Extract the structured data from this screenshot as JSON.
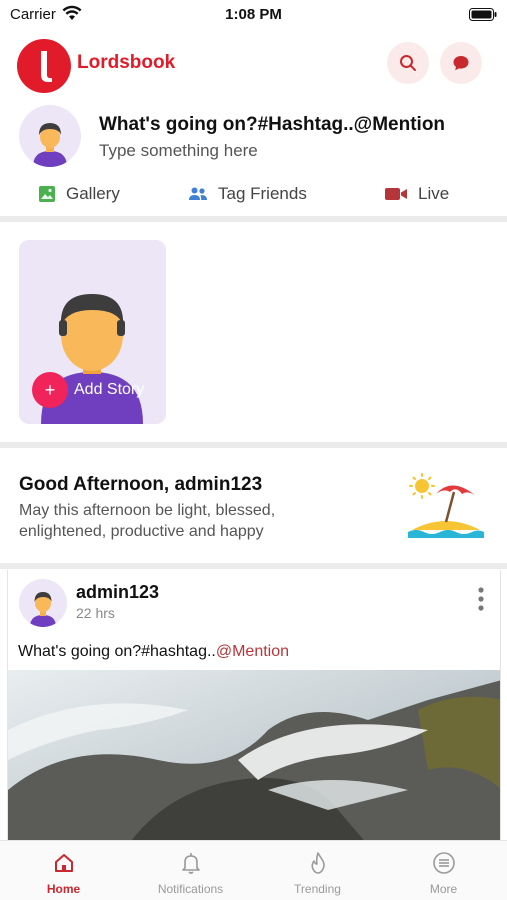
{
  "status_bar": {
    "carrier": "Carrier",
    "time": "1:08 PM"
  },
  "header": {
    "logo_text": "Lordsbook",
    "search_icon": "search-icon",
    "chat_icon": "chat-bubble-icon"
  },
  "composer": {
    "title": "What's going on?#Hashtag..@Mention",
    "subtitle": "Type something here",
    "actions": [
      {
        "label": "Gallery",
        "icon": "gallery-icon",
        "color": "#4caf50"
      },
      {
        "label": "Tag Friends",
        "icon": "people-icon",
        "color": "#3f7fd6"
      },
      {
        "label": "Live",
        "icon": "video-icon",
        "color": "#b5363a"
      }
    ]
  },
  "story": {
    "add_label": "Add Story",
    "add_symbol": "+"
  },
  "greeting": {
    "title": "Good Afternoon, admin123",
    "message": "May this afternoon be light, blessed, enlightened, productive and happy"
  },
  "post": {
    "author": "admin123",
    "time": "22 hrs",
    "text": "What's going on?#hashtag..",
    "mention": "@Mention"
  },
  "tabs": [
    {
      "label": "Home",
      "icon": "home-icon",
      "active": true
    },
    {
      "label": "Notifications",
      "icon": "bell-icon",
      "active": false
    },
    {
      "label": "Trending",
      "icon": "flame-icon",
      "active": false
    },
    {
      "label": "More",
      "icon": "menu-icon",
      "active": false
    }
  ],
  "colors": {
    "brand": "#e21b2a",
    "accent": "#c8282e",
    "story_add": "#f0245a"
  }
}
